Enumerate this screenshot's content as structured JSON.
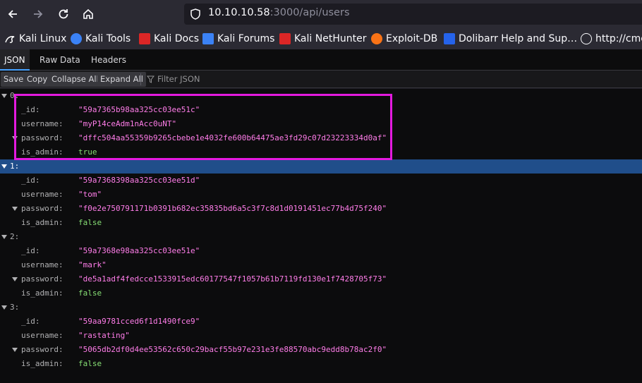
{
  "browser": {
    "url_host": "10.10.10.58",
    "url_path": ":3000/api/users",
    "icons": {
      "back": "arrow-left-icon",
      "forward": "arrow-right-icon",
      "reload": "reload-icon",
      "home": "home-icon",
      "security": "shield-icon"
    }
  },
  "bookmarks": [
    {
      "label": "Kali Linux",
      "icon": "kali-dragon-icon",
      "color": "#ffffff"
    },
    {
      "label": "Kali Tools",
      "icon": "kali-tools-icon",
      "color": "#3b82f6"
    },
    {
      "label": "Kali Docs",
      "icon": "kali-docs-icon",
      "color": "#dc2626"
    },
    {
      "label": "Kali Forums",
      "icon": "kali-forums-icon",
      "color": "#3b82f6"
    },
    {
      "label": "Kali NetHunter",
      "icon": "nethunter-icon",
      "color": "#dc2626"
    },
    {
      "label": "Exploit-DB",
      "icon": "exploit-db-icon",
      "color": "#f97316"
    },
    {
      "label": "Dolibarr Help and Sup…",
      "icon": "dolibarr-icon",
      "color": "#2563eb"
    },
    {
      "label": "http://cme",
      "icon": "globe-icon",
      "color": "#ffffff"
    }
  ],
  "viewer": {
    "tabs": [
      "JSON",
      "Raw Data",
      "Headers"
    ],
    "toolbar": {
      "save": "Save",
      "copy": "Copy",
      "collapse_all": "Collapse All",
      "expand_all": "Expand All",
      "filter_placeholder": "Filter JSON"
    }
  },
  "users": [
    {
      "index": "0:",
      "id_key": "_id:",
      "id": "\"59a7365b98aa325cc03ee51c\"",
      "username_key": "username:",
      "username": "\"myP14ceAdm1nAcc0uNT\"",
      "password_key": "password:",
      "password": "\"dffc504aa55359b9265cbebe1e4032fe600b64475ae3fd29c07d23223334d0af\"",
      "admin_key": "is_admin:",
      "is_admin": "true"
    },
    {
      "index": "1:",
      "id_key": "_id:",
      "id": "\"59a7368398aa325cc03ee51d\"",
      "username_key": "username:",
      "username": "\"tom\"",
      "password_key": "password:",
      "password": "\"f0e2e750791171b0391b682ec35835bd6a5c3f7c8d1d0191451ec77b4d75f240\"",
      "admin_key": "is_admin:",
      "is_admin": "false"
    },
    {
      "index": "2:",
      "id_key": "_id:",
      "id": "\"59a7368e98aa325cc03ee51e\"",
      "username_key": "username:",
      "username": "\"mark\"",
      "password_key": "password:",
      "password": "\"de5a1adf4fedcce1533915edc60177547f1057b61b7119fd130e1f7428705f73\"",
      "admin_key": "is_admin:",
      "is_admin": "false"
    },
    {
      "index": "3:",
      "id_key": "_id:",
      "id": "\"59aa9781cced6f1d1490fce9\"",
      "username_key": "username:",
      "username": "\"rastating\"",
      "password_key": "password:",
      "password": "\"5065db2df0d4ee53562c650c29bacf55b97e231e3fe88570abc9edd8b78ac2f0\"",
      "admin_key": "is_admin:",
      "is_admin": "false"
    }
  ],
  "colors": {
    "string_value": "#ff7de9",
    "bool_value": "#86de74",
    "selection": "#204e8a",
    "highlight_box": "#e41adf"
  }
}
